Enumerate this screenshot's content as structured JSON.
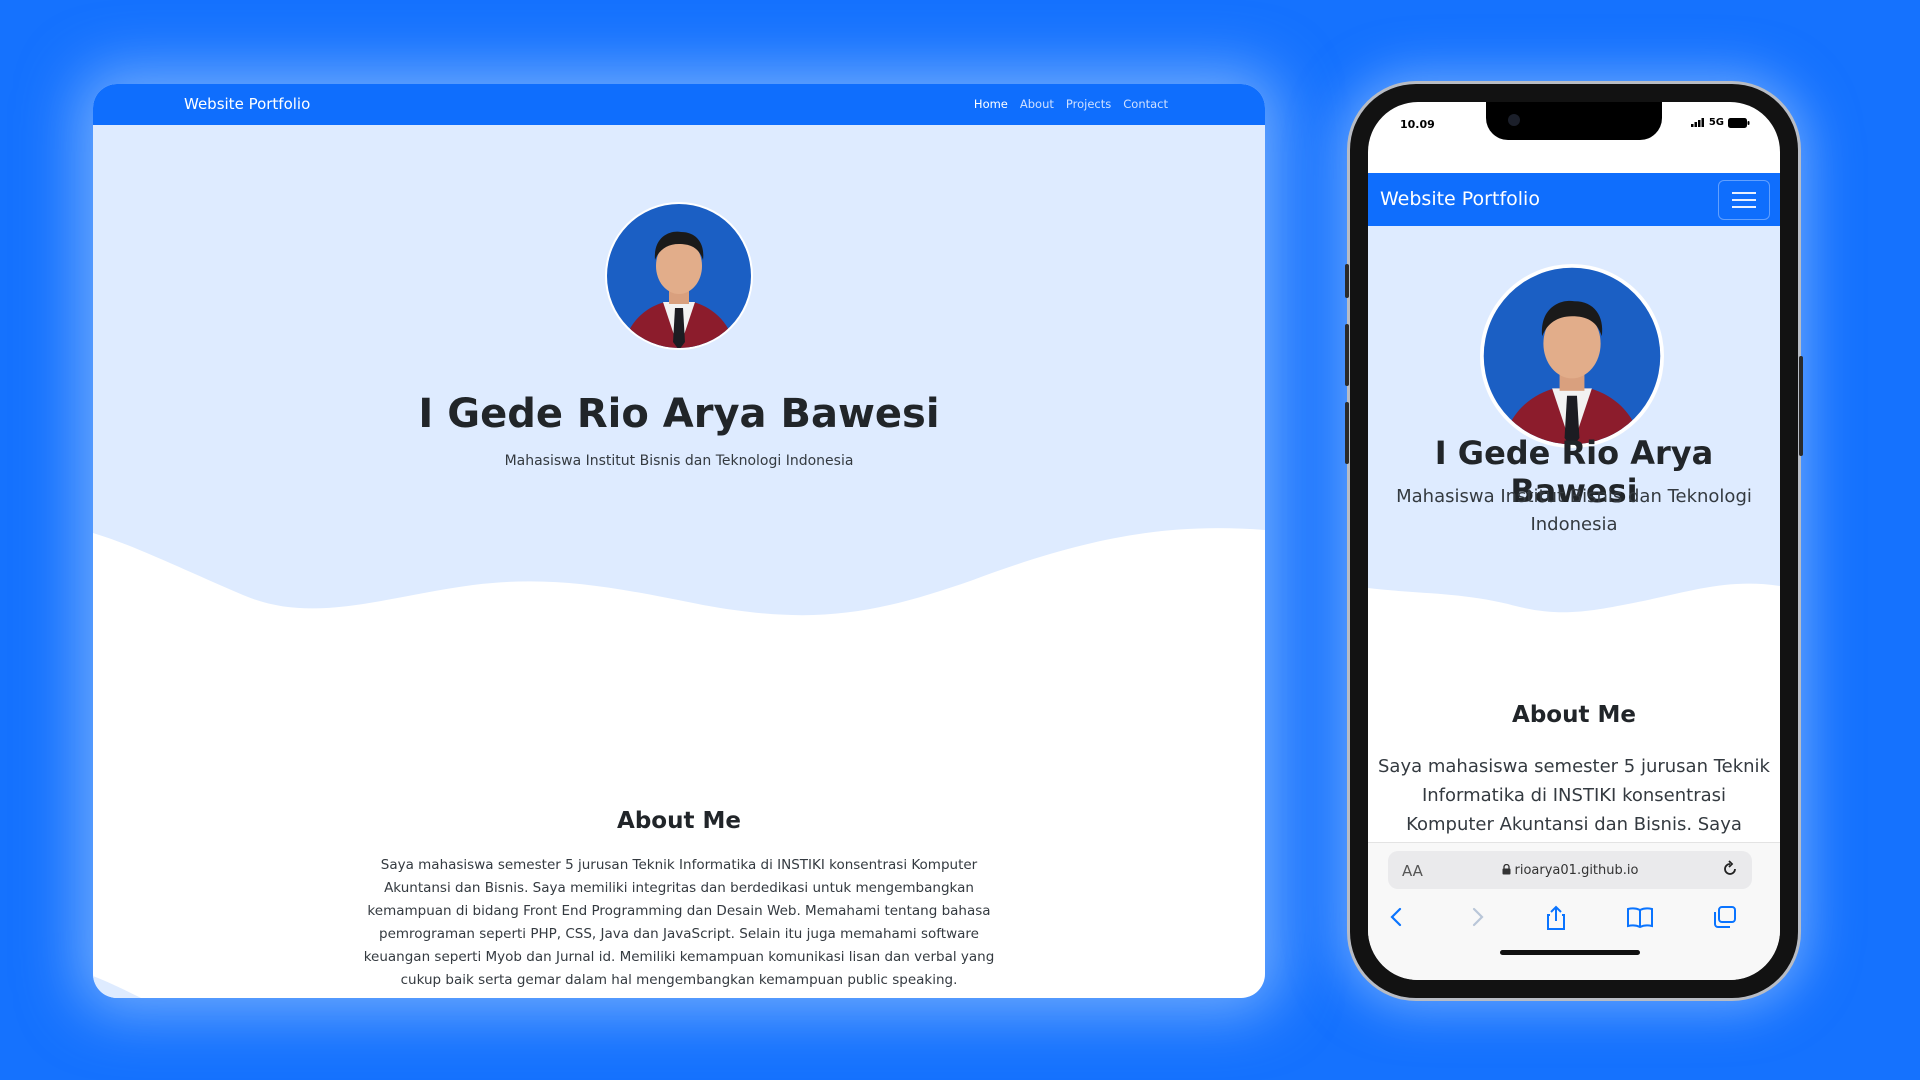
{
  "site": {
    "brand": "Website Portfolio",
    "nav": [
      "Home",
      "About",
      "Projects",
      "Contact"
    ],
    "active_nav": "Home",
    "name": "I Gede Rio Arya Bawesi",
    "subtitle": "Mahasiswa Institut Bisnis dan Teknologi Indonesia",
    "about_title": "About Me",
    "about_text": "Saya mahasiswa semester 5 jurusan Teknik Informatika di INSTIKI konsentrasi Komputer Akuntansi dan Bisnis. Saya memiliki integritas dan berdedikasi untuk mengembangkan kemampuan di bidang Front End Programming dan Desain Web. Memahami tentang bahasa pemrograman seperti PHP, CSS, Java dan JavaScript. Selain itu juga memahami software keuangan seperti Myob dan Jurnal id. Memiliki kemampuan komunikasi lisan dan verbal yang cukup baik serta gemar dalam hal mengembangkan kemampuan public speaking."
  },
  "phone": {
    "time": "10.09",
    "network": "5G",
    "about_visible": "Saya mahasiswa semester 5 jurusan Teknik Informatika di INSTIKI konsentrasi Komputer Akuntansi dan Bisnis. Saya memiliki integritas",
    "address_aa": "AA",
    "url": "rioarya01.github.io"
  },
  "colors": {
    "page_bg": "#1572fe",
    "navbar": "#0f6efd",
    "hero_bg": "#deebff",
    "text_dark": "#212529"
  },
  "icons": [
    "hamburger-menu-icon",
    "lock-icon",
    "reload-icon",
    "back-icon",
    "forward-icon",
    "share-icon",
    "bookmarks-icon",
    "tabs-icon",
    "signal-icon",
    "battery-icon"
  ]
}
